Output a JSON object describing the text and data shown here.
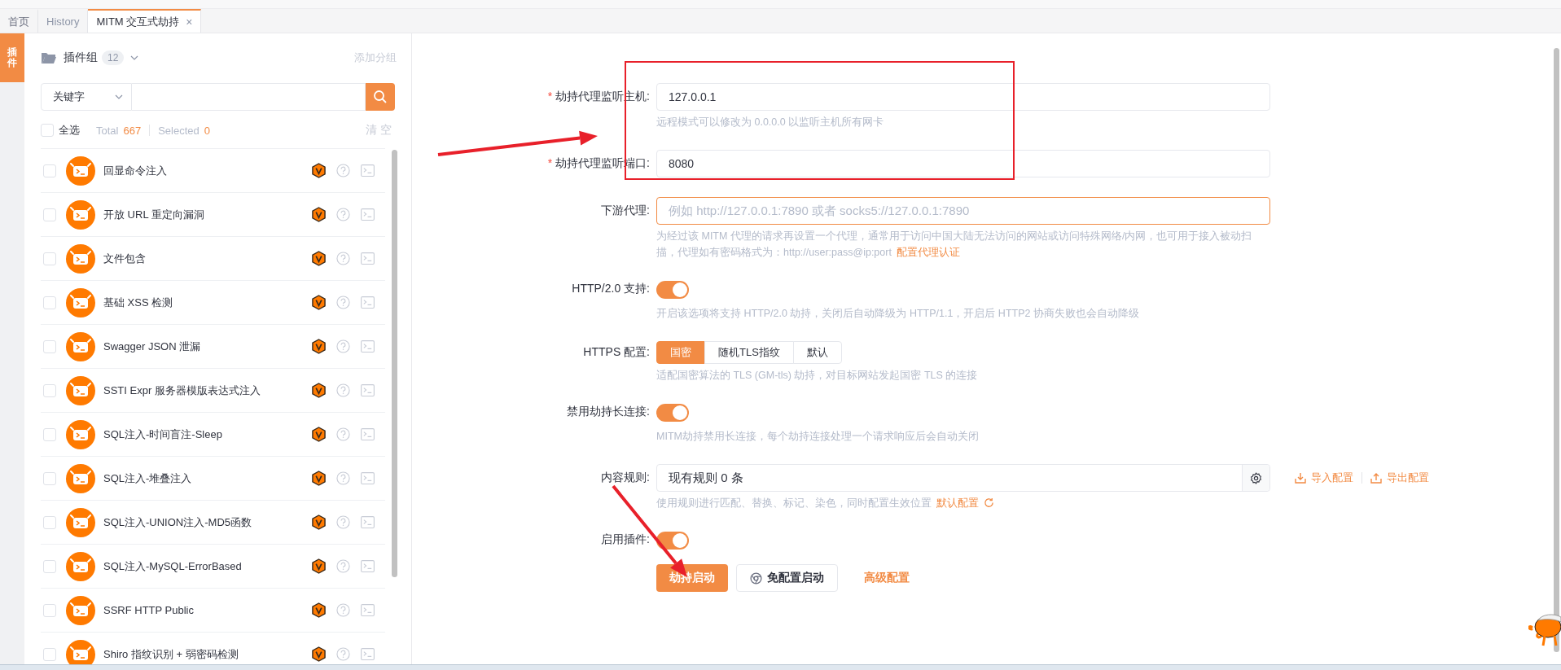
{
  "tabs": [
    {
      "label": "首页",
      "selected": false
    },
    {
      "label": "History",
      "selected": false
    },
    {
      "label": "MITM 交互式劫持",
      "selected": true,
      "close": "×"
    }
  ],
  "side_tab": {
    "label": "插件",
    "selected": true
  },
  "plugin_panel": {
    "group_label": "插件组",
    "group_count": "12",
    "add_group": "添加分组",
    "search_type": "关键字",
    "select_all": {
      "label": "全选",
      "checked": false
    },
    "total_label": "Total",
    "total": "667",
    "selected_label": "Selected",
    "selected_count": "0",
    "clear": "清空"
  },
  "plugins": [
    {
      "name": "回显命令注入",
      "checked": false
    },
    {
      "name": "开放 URL 重定向漏洞",
      "checked": false
    },
    {
      "name": "文件包含",
      "checked": false
    },
    {
      "name": "基础 XSS 检测",
      "checked": false
    },
    {
      "name": "Swagger JSON 泄漏",
      "checked": false
    },
    {
      "name": "SSTI Expr 服务器模版表达式注入",
      "checked": false
    },
    {
      "name": "SQL注入-时间盲注-Sleep",
      "checked": false
    },
    {
      "name": "SQL注入-堆叠注入",
      "checked": false
    },
    {
      "name": "SQL注入-UNION注入-MD5函数",
      "checked": false
    },
    {
      "name": "SQL注入-MySQL-ErrorBased",
      "checked": false
    },
    {
      "name": "SSRF HTTP Public",
      "checked": false
    },
    {
      "name": "Shiro 指纹识别 + 弱密码检测",
      "checked": false
    }
  ],
  "form": [
    {
      "kind": "input",
      "label": "劫持代理监听主机:",
      "required_mark": "*",
      "focused": false,
      "value": "127.0.0.1",
      "help": "远程模式可以修改为 0.0.0.0 以监听主机所有网卡"
    },
    {
      "kind": "input",
      "label": "劫持代理监听端口:",
      "required_mark": "*",
      "focused": false,
      "value": "8080"
    },
    {
      "kind": "input",
      "label": "下游代理:",
      "focused": true,
      "placeholder": "例如 http://127.0.0.1:7890 或者 socks5://127.0.0.1:7890",
      "help": "为经过该 MITM 代理的请求再设置一个代理，通常用于访问中国大陆无法访问的网站或访问特殊网络/内网，也可用于接入被动扫描，代理如有密码格式为：http://user:pass@ip:port",
      "help_link": "配置代理认证"
    },
    {
      "kind": "toggle",
      "label": "HTTP/2.0 支持:",
      "on": true,
      "help": "开启该选项将支持 HTTP/2.0 劫持，关闭后自动降级为 HTTP/1.1，开启后 HTTP2 协商失败也会自动降级"
    },
    {
      "kind": "segmented",
      "label": "HTTPS 配置:",
      "options": [
        {
          "label": "国密",
          "selected": true
        },
        {
          "label": "随机TLS指纹",
          "selected": false
        },
        {
          "label": "默认",
          "selected": false
        }
      ],
      "help": "适配国密算法的 TLS (GM-tls) 劫持，对目标网站发起国密 TLS 的连接"
    },
    {
      "kind": "toggle",
      "label": "禁用劫持长连接:",
      "on": true,
      "help": "MITM劫持禁用长连接，每个劫持连接处理一个请求响应后会自动关闭"
    },
    {
      "kind": "rules",
      "label": "内容规则:",
      "value": "现有规则 0 条",
      "actions": [
        {
          "kind": "import",
          "label": "导入配置"
        },
        {
          "kind": "export",
          "label": "导出配置"
        }
      ],
      "help": "使用规则进行匹配、替换、标记、染色，同时配置生效位置",
      "help_link": "默认配置"
    },
    {
      "kind": "toggle",
      "label": "启用插件:",
      "on": true
    }
  ],
  "actions": [
    {
      "kind": "primary",
      "label": "劫持启动"
    },
    {
      "kind": "secondary",
      "label": "免配置启动"
    },
    {
      "kind": "link",
      "label": "高级配置"
    }
  ],
  "annotations": [
    {
      "kind": "box"
    },
    {
      "kind": "arrow"
    },
    {
      "kind": "arrow"
    }
  ]
}
